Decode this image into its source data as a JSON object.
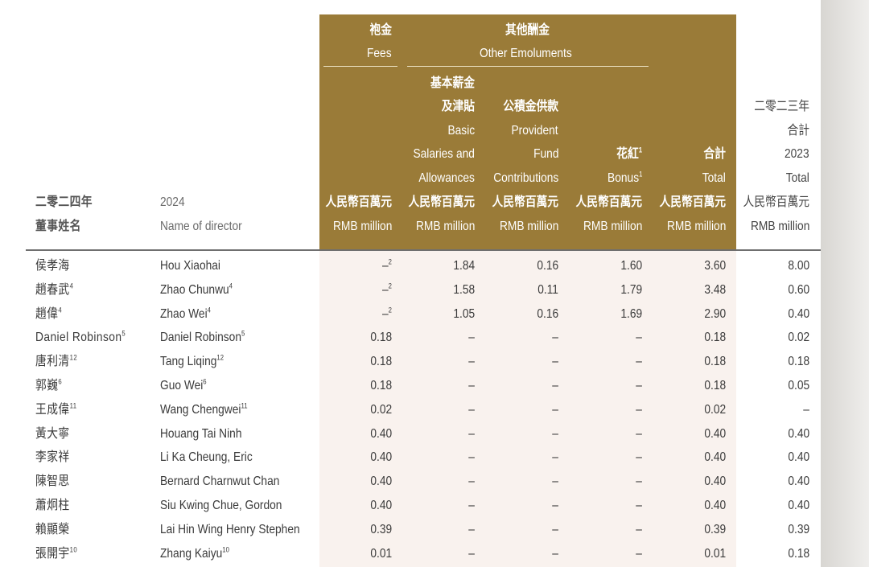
{
  "header": {
    "fees_zh": "袍金",
    "fees_en": "Fees",
    "other_zh": "其他酬金",
    "other_en": "Other Emoluments",
    "basic_zh1": "基本薪金",
    "basic_zh2": "及津貼",
    "basic_en1": "Basic",
    "basic_en2": "Salaries and",
    "basic_en3": "Allowances",
    "pf_zh": "公積金供款",
    "pf_en1": "Provident",
    "pf_en2": "Fund",
    "pf_en3": "Contributions",
    "bonus_zh": "花紅",
    "bonus_en": "Bonus",
    "bonus_sup": "1",
    "total_zh": "合計",
    "total_en": "Total",
    "y2023_zh1": "二零二三年",
    "y2023_zh2": "合計",
    "y2023_en1": "2023",
    "y2023_en2": "Total",
    "unit_zh": "人民幣百萬元",
    "unit_en": "RMB million",
    "year_zh": "二零二四年",
    "name_zh": "董事姓名",
    "year_en": "2024",
    "name_en": "Name of director"
  },
  "rows": [
    {
      "zh": "侯孝海",
      "zh_sup": "",
      "en": "Hou Xiaohai",
      "en_sup": "",
      "fees": "–",
      "fees_sup": "2",
      "basic": "1.84",
      "pf": "0.16",
      "bonus": "1.60",
      "total": "3.60",
      "prev": "8.00"
    },
    {
      "zh": "趙春武",
      "zh_sup": "4",
      "en": "Zhao Chunwu",
      "en_sup": "4",
      "fees": "–",
      "fees_sup": "2",
      "basic": "1.58",
      "pf": "0.11",
      "bonus": "1.79",
      "total": "3.48",
      "prev": "0.60"
    },
    {
      "zh": "趙偉",
      "zh_sup": "4",
      "en": "Zhao Wei",
      "en_sup": "4",
      "fees": "–",
      "fees_sup": "2",
      "basic": "1.05",
      "pf": "0.16",
      "bonus": "1.69",
      "total": "2.90",
      "prev": "0.40"
    },
    {
      "zh": "Daniel Robinson",
      "zh_sup": "5",
      "en": "Daniel Robinson",
      "en_sup": "5",
      "fees": "0.18",
      "fees_sup": "",
      "basic": "–",
      "pf": "–",
      "bonus": "–",
      "total": "0.18",
      "prev": "0.02"
    },
    {
      "zh": "唐利清",
      "zh_sup": "12",
      "en": "Tang Liqing",
      "en_sup": "12",
      "fees": "0.18",
      "fees_sup": "",
      "basic": "–",
      "pf": "–",
      "bonus": "–",
      "total": "0.18",
      "prev": "0.18"
    },
    {
      "zh": "郭巍",
      "zh_sup": "6",
      "en": "Guo Wei",
      "en_sup": "6",
      "fees": "0.18",
      "fees_sup": "",
      "basic": "–",
      "pf": "–",
      "bonus": "–",
      "total": "0.18",
      "prev": "0.05"
    },
    {
      "zh": "王成偉",
      "zh_sup": "11",
      "en": "Wang Chengwei",
      "en_sup": "11",
      "fees": "0.02",
      "fees_sup": "",
      "basic": "–",
      "pf": "–",
      "bonus": "–",
      "total": "0.02",
      "prev": "–"
    },
    {
      "zh": "黃大寧",
      "zh_sup": "",
      "en": "Houang Tai Ninh",
      "en_sup": "",
      "fees": "0.40",
      "fees_sup": "",
      "basic": "–",
      "pf": "–",
      "bonus": "–",
      "total": "0.40",
      "prev": "0.40"
    },
    {
      "zh": "李家祥",
      "zh_sup": "",
      "en": "Li Ka Cheung, Eric",
      "en_sup": "",
      "fees": "0.40",
      "fees_sup": "",
      "basic": "–",
      "pf": "–",
      "bonus": "–",
      "total": "0.40",
      "prev": "0.40"
    },
    {
      "zh": "陳智思",
      "zh_sup": "",
      "en": "Bernard Charnwut Chan",
      "en_sup": "",
      "fees": "0.40",
      "fees_sup": "",
      "basic": "–",
      "pf": "–",
      "bonus": "–",
      "total": "0.40",
      "prev": "0.40"
    },
    {
      "zh": "蕭炯柱",
      "zh_sup": "",
      "en": "Siu Kwing Chue, Gordon",
      "en_sup": "",
      "fees": "0.40",
      "fees_sup": "",
      "basic": "–",
      "pf": "–",
      "bonus": "–",
      "total": "0.40",
      "prev": "0.40"
    },
    {
      "zh": "賴顯榮",
      "zh_sup": "",
      "en": "Lai Hin Wing Henry Stephen",
      "en_sup": "",
      "fees": "0.39",
      "fees_sup": "",
      "basic": "–",
      "pf": "–",
      "bonus": "–",
      "total": "0.39",
      "prev": "0.39"
    },
    {
      "zh": "張開宇",
      "zh_sup": "10",
      "en": "Zhang Kaiyu",
      "en_sup": "10",
      "fees": "0.01",
      "fees_sup": "",
      "basic": "–",
      "pf": "–",
      "bonus": "–",
      "total": "0.01",
      "prev": "0.18"
    }
  ]
}
